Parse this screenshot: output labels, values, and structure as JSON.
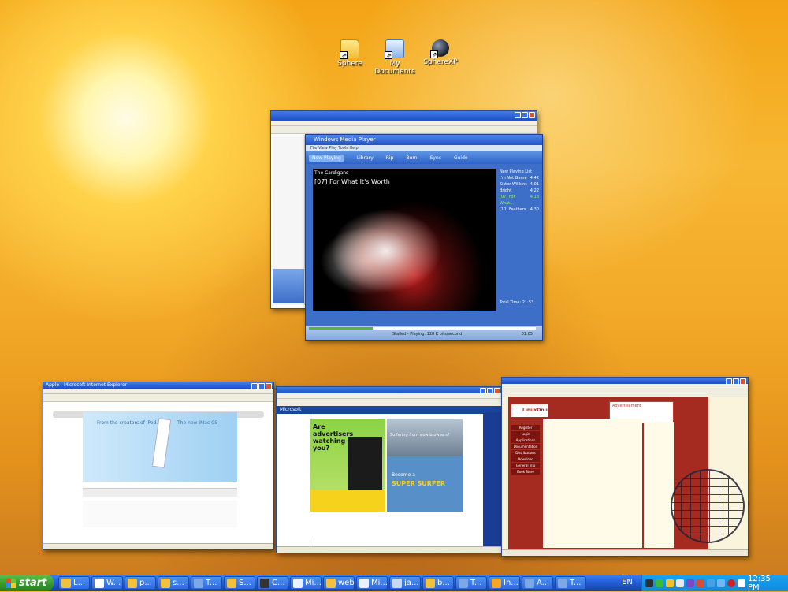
{
  "desktop": {
    "icons": [
      {
        "label": "Sphere",
        "icon": "folder-icon"
      },
      {
        "label": "My Documents",
        "icon": "my-documents-icon"
      },
      {
        "label": "SphereXP",
        "icon": "spherexp-icon"
      }
    ]
  },
  "windows": {
    "wmp": {
      "title": "Windows Media Player",
      "menu": "File  View  Play  Tools  Help",
      "tabs": [
        "Now Playing",
        "Library",
        "Rip",
        "Burn",
        "Sync",
        "Guide"
      ],
      "artist": "The Cardigans",
      "track": "[07] For What It's Worth",
      "playlist_title": "New Playing List",
      "playlist": [
        {
          "name": "I'm Not Game",
          "time": "4:42"
        },
        {
          "name": "Sister Willkins",
          "time": "4:01"
        },
        {
          "name": "Bright",
          "time": "4:22"
        },
        {
          "name": "[07] For What...",
          "time": "4:18"
        },
        {
          "name": "[10] Feathers",
          "time": "4:30"
        }
      ],
      "total_time": "Total Time: 21:53",
      "status": "Stalled - Playing: 128 K bits/second",
      "elapsed": "01:05",
      "seek_progress": 0.28,
      "colors": {
        "accent": "#2c63c9",
        "playing": "#9df26a"
      }
    },
    "apple": {
      "title": "Apple - Microsoft Internet Explorer",
      "hero_left": "From the creators of iPod.",
      "hero_right": "The new iMac G5"
    },
    "msn": {
      "title": "Microsoft",
      "ad_text": "Are advertisers watching you?",
      "promo_caption": "Suffering from slow browsers?",
      "promo_line1": "Become a",
      "promo_line2": "SUPER SURFER"
    },
    "linux": {
      "logo": "LinuxOnline!",
      "menu": [
        "Register",
        "Login",
        "Applications",
        "Documentation",
        "Distributions",
        "Download",
        "General Info",
        "Book Store"
      ],
      "ad": "Advertisement"
    }
  },
  "taskbar": {
    "start_label": "start",
    "tasks": [
      {
        "label": "L...",
        "color": "#f3c13b"
      },
      {
        "label": "W...",
        "color": "#ffffff"
      },
      {
        "label": "p...",
        "color": "#f3c13b"
      },
      {
        "label": "s...",
        "color": "#f3c13b"
      },
      {
        "label": "T...",
        "color": "#7da8e6"
      },
      {
        "label": "S...",
        "color": "#f3c13b"
      },
      {
        "label": "C...",
        "color": "#333333"
      },
      {
        "label": "Mi...",
        "color": "#e9f0ff"
      },
      {
        "label": "web",
        "color": "#f3c13b"
      },
      {
        "label": "Mi...",
        "color": "#e9f0ff"
      },
      {
        "label": "ja...",
        "color": "#c8d8f0"
      },
      {
        "label": "b...",
        "color": "#f3c13b"
      },
      {
        "label": "T...",
        "color": "#7da8e6"
      },
      {
        "label": "In...",
        "color": "#f6a623"
      },
      {
        "label": "A...",
        "color": "#7da8e6"
      },
      {
        "label": "T...",
        "color": "#7da8e6"
      }
    ],
    "language": "EN",
    "clock": "12:35 PM"
  }
}
